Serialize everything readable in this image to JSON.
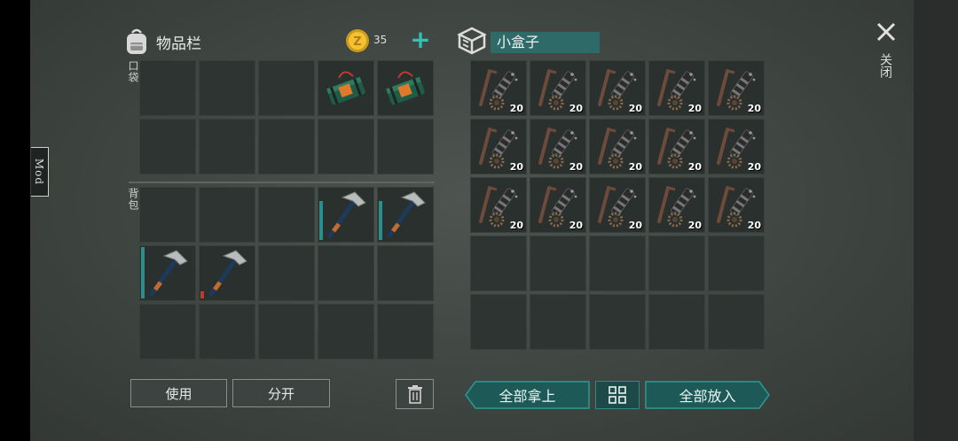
{
  "inventory": {
    "title": "物品栏",
    "coins": "35",
    "pocket_label": "口袋",
    "backpack_label": "背包"
  },
  "container": {
    "title": "小盒子",
    "stack_qty": "20"
  },
  "close": {
    "label": "关闭"
  },
  "mod_tab": {
    "label": "Mod"
  },
  "buttons": {
    "use": "使用",
    "split": "分开",
    "take_all": "全部拿上",
    "put_all": "全部放入"
  },
  "colors": {
    "teal_accent": "#2ec4b4",
    "durability_teal": "#2a8f8a",
    "durability_red": "#c0392b"
  },
  "icons": {
    "backpack": "backpack-icon",
    "coin": "coin-icon",
    "box": "box-icon",
    "close": "close-icon",
    "trash": "trash-icon",
    "sort": "grid-sort-icon",
    "hammer": "hammer-icon",
    "dynamite": "dynamite-icon",
    "crossbow_parts": "crossbow-parts-icon"
  }
}
